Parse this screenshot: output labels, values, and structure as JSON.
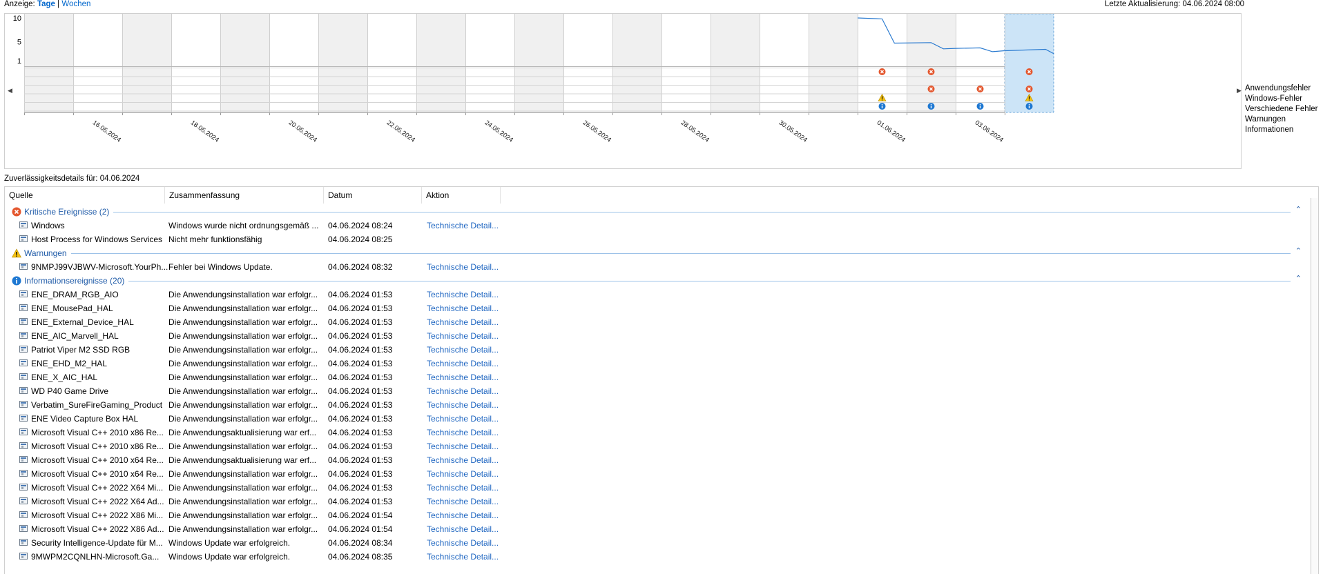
{
  "top": {
    "view_label": "Anzeige:",
    "days": "Tage",
    "sep": "|",
    "weeks": "Wochen",
    "last_update": "Letzte Aktualisierung: 04.06.2024 08:00"
  },
  "chart_data": {
    "type": "line",
    "yticks": [
      "10",
      "5",
      "1"
    ],
    "ylim": [
      1,
      10
    ],
    "date_labels": [
      "16.05.2024",
      "18.05.2024",
      "20.05.2024",
      "22.05.2024",
      "24.05.2024",
      "26.05.2024",
      "28.05.2024",
      "30.05.2024",
      "01.06.2024",
      "03.06.2024"
    ],
    "stability_index": [
      {
        "x": "01.06.2024 00:00",
        "y": 10
      },
      {
        "x": "01.06.2024 12:00",
        "y": 9.8
      },
      {
        "x": "01.06.2024 18:00",
        "y": 4.7
      },
      {
        "x": "02.06.2024 12:00",
        "y": 4.8
      },
      {
        "x": "02.06.2024 18:00",
        "y": 3.5
      },
      {
        "x": "03.06.2024 00:00",
        "y": 3.6
      },
      {
        "x": "03.06.2024 12:00",
        "y": 3.7
      },
      {
        "x": "03.06.2024 18:00",
        "y": 2.9
      },
      {
        "x": "04.06.2024 00:00",
        "y": 3.1
      },
      {
        "x": "04.06.2024 20:00",
        "y": 3.4
      },
      {
        "x": "04.06.2024 23:59",
        "y": 2.5
      }
    ],
    "selected_day": "04.06.2024",
    "legend": [
      "Anwendungsfehler",
      "Windows-Fehler",
      "Verschiedene Fehler",
      "Warnungen",
      "Informationen"
    ],
    "events": [
      {
        "day": "01.06.2024",
        "row": "Anwendungsfehler",
        "kind": "error"
      },
      {
        "day": "02.06.2024",
        "row": "Anwendungsfehler",
        "kind": "error"
      },
      {
        "day": "04.06.2024",
        "row": "Anwendungsfehler",
        "kind": "error"
      },
      {
        "day": "02.06.2024",
        "row": "Verschiedene Fehler",
        "kind": "error"
      },
      {
        "day": "03.06.2024",
        "row": "Verschiedene Fehler",
        "kind": "error"
      },
      {
        "day": "04.06.2024",
        "row": "Verschiedene Fehler",
        "kind": "error"
      },
      {
        "day": "01.06.2024",
        "row": "Warnungen",
        "kind": "warning"
      },
      {
        "day": "04.06.2024",
        "row": "Warnungen",
        "kind": "warning"
      },
      {
        "day": "01.06.2024",
        "row": "Informationen",
        "kind": "info"
      },
      {
        "day": "02.06.2024",
        "row": "Informationen",
        "kind": "info"
      },
      {
        "day": "03.06.2024",
        "row": "Informationen",
        "kind": "info"
      },
      {
        "day": "04.06.2024",
        "row": "Informationen",
        "kind": "info"
      }
    ]
  },
  "details": {
    "title": "Zuverlässigkeitsdetails für: 04.06.2024",
    "columns": [
      "Quelle",
      "Zusammenfassung",
      "Datum",
      "Aktion"
    ],
    "groups": [
      {
        "label": "Kritische Ereignisse (2)",
        "icon": "error-icon",
        "rows": [
          [
            "Windows",
            "Windows wurde nicht ordnungsgemäß ...",
            "04.06.2024 08:24",
            "Technische Detail..."
          ],
          [
            "Host Process for Windows Services",
            "Nicht mehr funktionsfähig",
            "04.06.2024 08:25",
            ""
          ]
        ]
      },
      {
        "label": "Warnungen",
        "icon": "warning-icon",
        "rows": [
          [
            "9NMPJ99VJBWV-Microsoft.YourPh...",
            "Fehler bei Windows Update.",
            "04.06.2024 08:32",
            "Technische Detail..."
          ]
        ]
      },
      {
        "label": "Informationsereignisse (20)",
        "icon": "info-icon",
        "rows": [
          [
            "ENE_DRAM_RGB_AIO",
            "Die Anwendungsinstallation war erfolgr...",
            "04.06.2024 01:53",
            "Technische Detail..."
          ],
          [
            "ENE_MousePad_HAL",
            "Die Anwendungsinstallation war erfolgr...",
            "04.06.2024 01:53",
            "Technische Detail..."
          ],
          [
            "ENE_External_Device_HAL",
            "Die Anwendungsinstallation war erfolgr...",
            "04.06.2024 01:53",
            "Technische Detail..."
          ],
          [
            "ENE_AIC_Marvell_HAL",
            "Die Anwendungsinstallation war erfolgr...",
            "04.06.2024 01:53",
            "Technische Detail..."
          ],
          [
            "Patriot Viper M2 SSD RGB",
            "Die Anwendungsinstallation war erfolgr...",
            "04.06.2024 01:53",
            "Technische Detail..."
          ],
          [
            "ENE_EHD_M2_HAL",
            "Die Anwendungsinstallation war erfolgr...",
            "04.06.2024 01:53",
            "Technische Detail..."
          ],
          [
            "ENE_X_AIC_HAL",
            "Die Anwendungsinstallation war erfolgr...",
            "04.06.2024 01:53",
            "Technische Detail..."
          ],
          [
            "WD P40 Game Drive",
            "Die Anwendungsinstallation war erfolgr...",
            "04.06.2024 01:53",
            "Technische Detail..."
          ],
          [
            "Verbatim_SureFireGaming_Product",
            "Die Anwendungsinstallation war erfolgr...",
            "04.06.2024 01:53",
            "Technische Detail..."
          ],
          [
            "ENE Video Capture Box HAL",
            "Die Anwendungsinstallation war erfolgr...",
            "04.06.2024 01:53",
            "Technische Detail..."
          ],
          [
            "Microsoft Visual C++ 2010  x86 Re...",
            "Die Anwendungsaktualisierung war erf...",
            "04.06.2024 01:53",
            "Technische Detail..."
          ],
          [
            "Microsoft Visual C++ 2010  x86 Re...",
            "Die Anwendungsinstallation war erfolgr...",
            "04.06.2024 01:53",
            "Technische Detail..."
          ],
          [
            "Microsoft Visual C++ 2010  x64 Re...",
            "Die Anwendungsaktualisierung war erf...",
            "04.06.2024 01:53",
            "Technische Detail..."
          ],
          [
            "Microsoft Visual C++ 2010  x64 Re...",
            "Die Anwendungsinstallation war erfolgr...",
            "04.06.2024 01:53",
            "Technische Detail..."
          ],
          [
            "Microsoft Visual C++ 2022 X64 Mi...",
            "Die Anwendungsinstallation war erfolgr...",
            "04.06.2024 01:53",
            "Technische Detail..."
          ],
          [
            "Microsoft Visual C++ 2022 X64 Ad...",
            "Die Anwendungsinstallation war erfolgr...",
            "04.06.2024 01:53",
            "Technische Detail..."
          ],
          [
            "Microsoft Visual C++ 2022 X86 Mi...",
            "Die Anwendungsinstallation war erfolgr...",
            "04.06.2024 01:54",
            "Technische Detail..."
          ],
          [
            "Microsoft Visual C++ 2022 X86 Ad...",
            "Die Anwendungsinstallation war erfolgr...",
            "04.06.2024 01:54",
            "Technische Detail..."
          ],
          [
            "Security Intelligence-Update für M...",
            "Windows Update war erfolgreich.",
            "04.06.2024 08:34",
            "Technische Detail..."
          ],
          [
            "9MWPM2CQNLHN-Microsoft.Ga...",
            "Windows Update war erfolgreich.",
            "04.06.2024 08:35",
            "Technische Detail..."
          ]
        ]
      }
    ]
  }
}
